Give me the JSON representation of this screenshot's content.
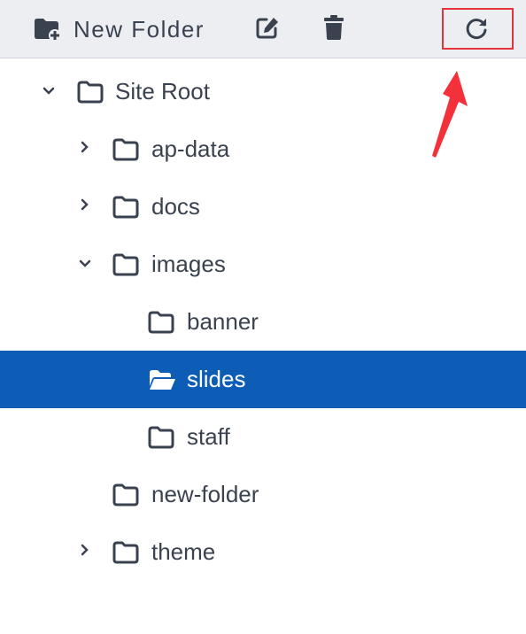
{
  "toolbar": {
    "new_folder_label": "New Folder",
    "new_folder_icon": "folder-plus-icon",
    "edit_icon": "edit-icon",
    "delete_icon": "trash-icon",
    "refresh_icon": "refresh-icon",
    "highlight_color": "#e9333b"
  },
  "tree": {
    "root": {
      "label": "Site Root",
      "expanded": true
    },
    "items": [
      {
        "label": "ap-data",
        "expanded": false,
        "has_children": true
      },
      {
        "label": "docs",
        "expanded": false,
        "has_children": true
      },
      {
        "label": "images",
        "expanded": true,
        "has_children": true
      },
      {
        "label": "banner",
        "has_children": false
      },
      {
        "label": "slides",
        "has_children": false,
        "selected": true,
        "open": true
      },
      {
        "label": "staff",
        "has_children": false
      },
      {
        "label": "new-folder",
        "has_children": false
      },
      {
        "label": "theme",
        "expanded": false,
        "has_children": true
      }
    ],
    "selected_color": "#0d5cb5"
  }
}
